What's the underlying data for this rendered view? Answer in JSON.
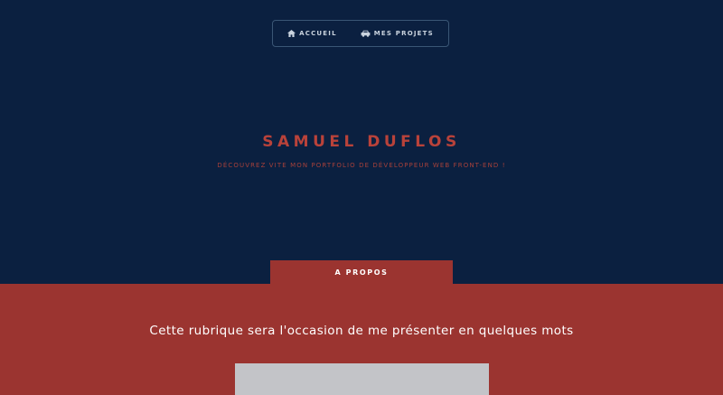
{
  "nav": {
    "home_label": "ACCUEIL",
    "projects_label": "MES PROJETS"
  },
  "hero": {
    "name": "SAMUEL DUFLOS",
    "tagline": "DÉCOUVREZ VITE MON PORTFOLIO DE DÉVELOPPEUR WEB FRONT-END !"
  },
  "about": {
    "tab_label": "A PROPOS",
    "text": "Cette rubrique sera l'occasion de me présenter en quelques mots"
  },
  "colors": {
    "navy": "#0b2040",
    "brick": "#9b3430",
    "accent_text": "#b9423a"
  },
  "icons": [
    "home-icon",
    "car-icon"
  ]
}
